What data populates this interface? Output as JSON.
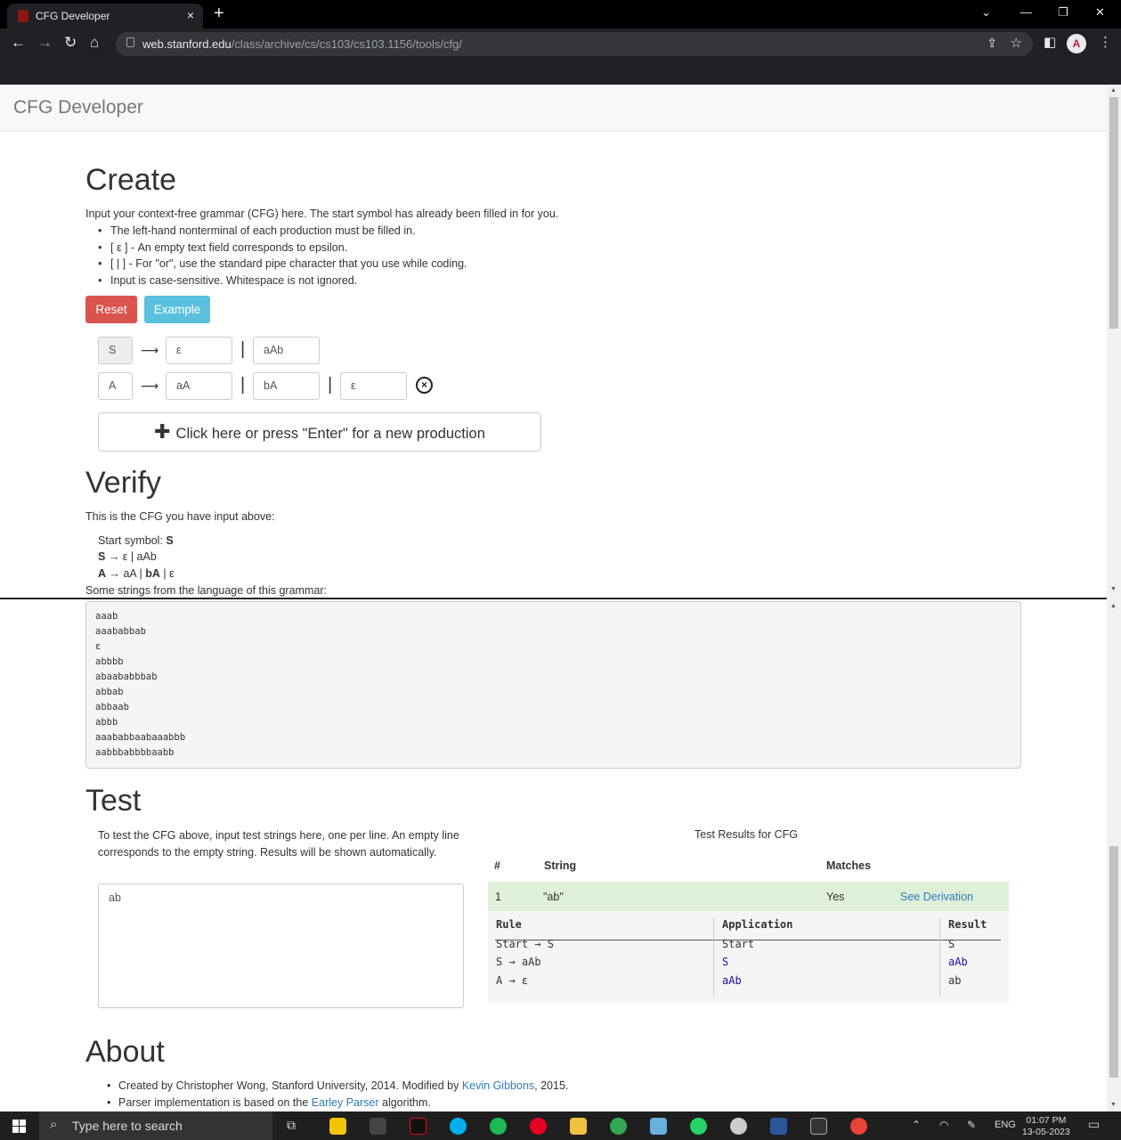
{
  "browser": {
    "tab_title": "CFG Developer",
    "tab_close": "×",
    "new_tab": "+",
    "url_host": "web.stanford.edu",
    "url_path": "/class/archive/cs/cs103/cs103.1156/tools/cfg/",
    "win_minimize": "—",
    "win_restore": "❐",
    "win_close": "✕",
    "win_menu": "⌄",
    "avatar_letter": "A"
  },
  "navbar": {
    "brand": "CFG Developer"
  },
  "create": {
    "heading": "Create",
    "intro": "Input your context-free grammar (CFG) here. The start symbol has already been filled in for you.",
    "rules": [
      "The left-hand nonterminal of each production must be filled in.",
      "[ ε ] - An empty text field corresponds to epsilon.",
      "[ | ] - For \"or\", use the standard pipe character that you use while coding.",
      "Input is case-sensitive. Whitespace is not ignored."
    ],
    "reset_label": "Reset",
    "example_label": "Example",
    "productions": [
      {
        "lhs": "S",
        "rhs": [
          "ε",
          "aAb"
        ]
      },
      {
        "lhs": "A",
        "rhs": [
          "aA",
          "bA",
          "ε"
        ]
      }
    ],
    "arrow": "⟶",
    "pipe": "|",
    "remove_symbol": "×",
    "new_production_plus": "✚",
    "new_production_label": "Click here or press \"Enter\" for a new production"
  },
  "verify": {
    "heading": "Verify",
    "intro": "This is the CFG you have input above:",
    "start_label": "Start symbol: ",
    "start_symbol": "S",
    "lines": [
      {
        "lhs": "S",
        "rhs": " → ε | aAb"
      },
      {
        "lhs": "A",
        "rhs_parts": [
          " → aA",
          " | ",
          "bA",
          " | ε"
        ]
      }
    ],
    "strings_label": "Some strings from the language of this grammar:",
    "strings": [
      "aaab",
      "aaababbab",
      "ε",
      "abbbb",
      "abaababbbab",
      "abbab",
      "abbaab",
      "abbb",
      "aaababbaabaaabbb",
      "aabbbabbbbaabb"
    ]
  },
  "test": {
    "heading": "Test",
    "instructions": "To test the CFG above, input test strings here, one per line. An empty line corresponds to the empty string. Results will be shown automatically.",
    "input_value": "ab",
    "results_title": "Test Results for CFG",
    "headers": {
      "num": "#",
      "string": "String",
      "matches": "Matches"
    },
    "results": [
      {
        "num": "1",
        "string": "\"ab\"",
        "matches": "Yes",
        "derivation_link": "See Derivation"
      }
    ],
    "derivation": {
      "headers": {
        "rule": "Rule",
        "application": "Application",
        "result": "Result"
      },
      "rows": [
        {
          "rule": "Start → S",
          "application": "Start",
          "result": "S"
        },
        {
          "rule": "S → aAb",
          "application": "S",
          "result": "aAb"
        },
        {
          "rule": "A → ε",
          "application": "aAb",
          "result": "ab"
        }
      ]
    }
  },
  "about": {
    "heading": "About",
    "line1_pre": "Created by Christopher Wong, Stanford University, 2014. Modified by ",
    "line1_link": "Kevin Gibbons",
    "line1_post": ", 2015.",
    "line2_pre": "Parser implementation is based on the ",
    "line2_link": "Earley Parser",
    "line2_post": " algorithm."
  },
  "taskbar": {
    "search_placeholder": "Type here to search",
    "lang": "ENG",
    "time": "01:07 PM",
    "date": "13-05-2023"
  },
  "colors": {
    "reset": "#d9534f",
    "example": "#5bc0de",
    "match_row": "#dff0d8",
    "link": "#337ab7"
  }
}
